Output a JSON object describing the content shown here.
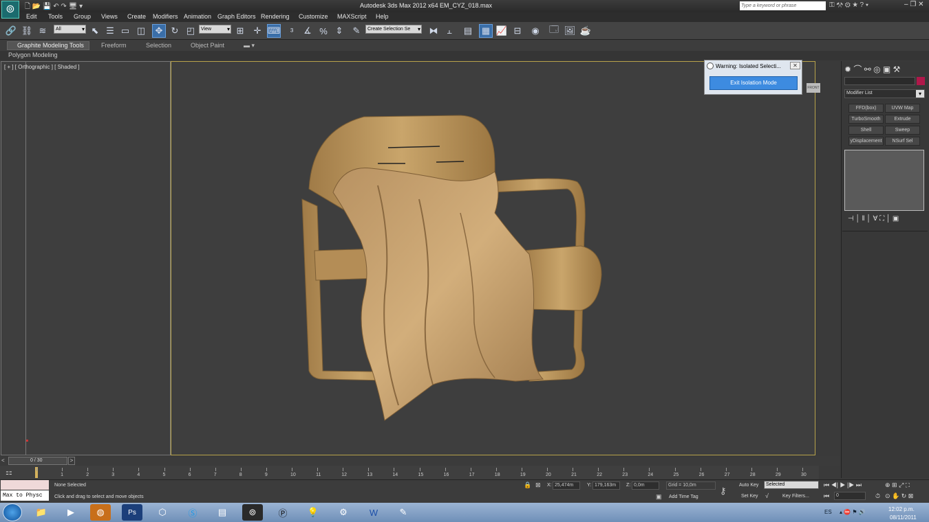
{
  "title": {
    "app": "Autodesk 3ds Max  2012 x64",
    "file": "EM_CYZ_018.max",
    "search_placeholder": "Type a keyword or phrase"
  },
  "menu": [
    "Edit",
    "Tools",
    "Group",
    "Views",
    "Create",
    "Modifiers",
    "Animation",
    "Graph Editors",
    "Rendering",
    "Customize",
    "MAXScript",
    "Help"
  ],
  "toolbar": {
    "filter": "All",
    "refcoord": "View",
    "selset": "Create Selection Se"
  },
  "ribbon": {
    "tabs": [
      "Graphite Modeling Tools",
      "Freeform",
      "Selection",
      "Object Paint"
    ],
    "sub": "Polygon Modeling"
  },
  "viewport": {
    "label": "[ + ] [ Orthographic ] [ Shaded ]"
  },
  "warning": {
    "title": "Warning: Isolated Selecti...",
    "button": "Exit Isolation Mode",
    "cube": "FRONT"
  },
  "cmd": {
    "modlist": "Modifier List",
    "mods": [
      "FFD(box)",
      "UVW Map",
      "TurboSmooth",
      "Extrude",
      "Shell",
      "Sweep",
      "yDisplacement",
      "NSurf Sel"
    ]
  },
  "timeline": {
    "frame": "0 / 30",
    "ticks": [
      "0",
      "1",
      "2",
      "3",
      "4",
      "5",
      "6",
      "7",
      "8",
      "9",
      "10",
      "11",
      "12",
      "13",
      "14",
      "15",
      "16",
      "17",
      "18",
      "19",
      "20",
      "21",
      "22",
      "23",
      "24",
      "25",
      "26",
      "27",
      "28",
      "29",
      "30"
    ]
  },
  "status": {
    "script": "Max to Physc",
    "sel": "None Selected",
    "hint": "Click and drag to select and move objects",
    "x": "25,474m",
    "y": "179,163m",
    "z": "0,0m",
    "grid": "Grid = 10,0m",
    "addtime": "Add Time Tag",
    "autokey": "Auto Key",
    "selected": "Selected",
    "setkey": "Set Key",
    "keyfilters": "Key Filters...",
    "frame_field": "0"
  },
  "tray": {
    "lang": "ES",
    "time": "12:02 p.m.",
    "date": "08/11/2011"
  }
}
